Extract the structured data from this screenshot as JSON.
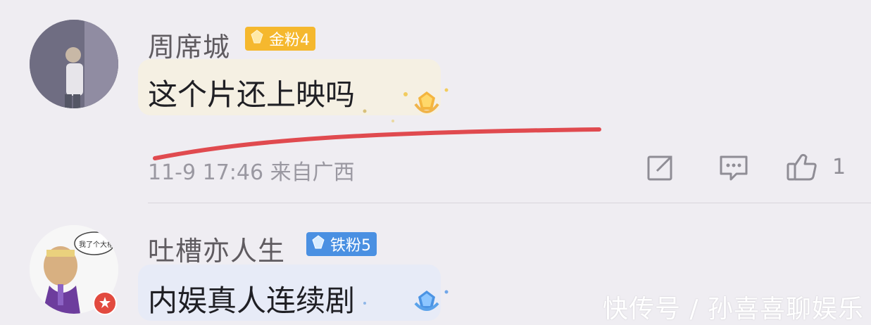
{
  "comments": [
    {
      "username": "周席城",
      "badge": {
        "label": "金粉4",
        "color": "#f5b82e",
        "icon": "diamond-icon"
      },
      "text": "这个片还上映吗",
      "meta": "11-9 17:46 来自广西",
      "like_count": "1"
    },
    {
      "username": "吐槽亦人生",
      "badge": {
        "label": "铁粉5",
        "color": "#4a90e2",
        "icon": "diamond-icon"
      },
      "text": "内娱真人连续剧"
    }
  ],
  "actions": {
    "share_icon": "share-icon",
    "comment_icon": "comment-icon",
    "like_icon": "thumbs-up-icon"
  },
  "watermark": "快传号 / 孙喜喜聊娱乐",
  "colors": {
    "background": "#efedf2",
    "red_annotation": "#e04a4f"
  }
}
